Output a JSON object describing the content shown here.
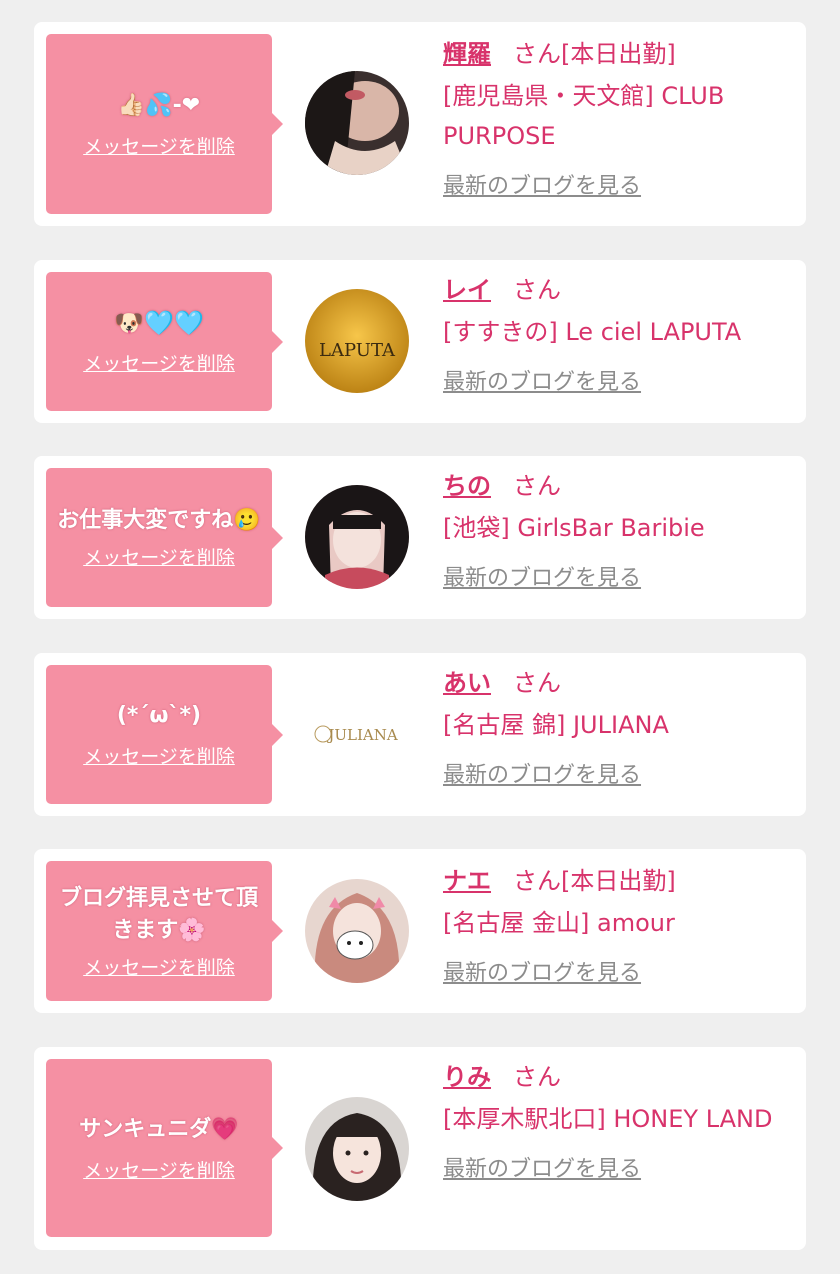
{
  "colors": {
    "background": "#efefef",
    "card": "#ffffff",
    "bubble": "#f590a3",
    "accent": "#d8336b",
    "link_gray": "#8c8c8c"
  },
  "delete_label": "メッセージを削除",
  "blog_label": "最新のブログを見る",
  "san_label": "さん",
  "items": [
    {
      "message": "👍🏻💦-❤",
      "name": "輝羅",
      "status": "[本日出勤]",
      "shop": "[鹿児島県・天文館] CLUB PURPOSE"
    },
    {
      "message": "🐶🩵🩵",
      "name": "レイ",
      "status": "",
      "shop": "[すすきの] Le ciel LAPUTA",
      "avatar_logo_text": "LAPUTA"
    },
    {
      "message": "お仕事大変ですね🥲",
      "name": "ちの",
      "status": "",
      "shop": "[池袋] GirlsBar Baribie"
    },
    {
      "message": "(*´ω`*)",
      "name": "あい",
      "status": "",
      "shop": "[名古屋 錦] JULIANA",
      "avatar_logo_text": "JULIANA"
    },
    {
      "message": "ブログ拝見させて頂きます🌸",
      "name": "ナエ",
      "status": "[本日出勤]",
      "shop": "[名古屋 金山] amour"
    },
    {
      "message": "サンキュニダ💗",
      "name": "りみ",
      "status": "",
      "shop": "[本厚木駅北口] HONEY LAND"
    }
  ]
}
